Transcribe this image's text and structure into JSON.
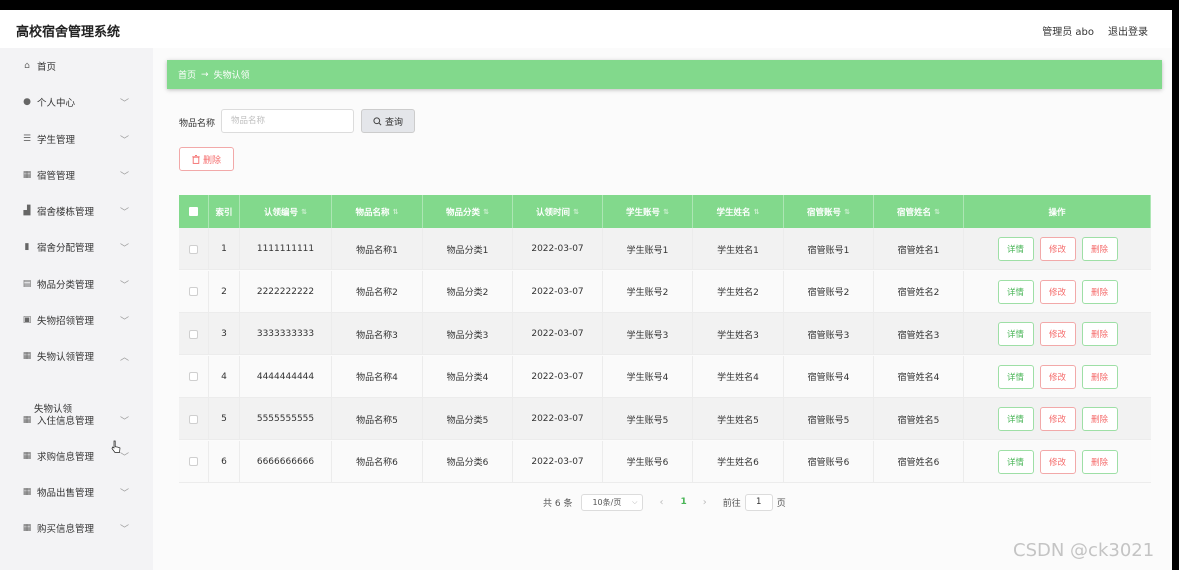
{
  "app_title": "高校宿舍管理系统",
  "header": {
    "user_label": "管理员 abo",
    "logout_label": "退出登录"
  },
  "sidebar": {
    "items": [
      {
        "label": "首页",
        "icon": "home-icon"
      },
      {
        "label": "个人中心",
        "icon": "user-icon"
      },
      {
        "label": "学生管理",
        "icon": "sliders-icon"
      },
      {
        "label": "宿管管理",
        "icon": "grid-icon"
      },
      {
        "label": "宿舍楼栋管理",
        "icon": "building-icon"
      },
      {
        "label": "宿舍分配管理",
        "icon": "bar-chart-icon"
      },
      {
        "label": "物品分类管理",
        "icon": "clipboard-icon"
      },
      {
        "label": "失物招领管理",
        "icon": "image-icon"
      },
      {
        "label": "失物认领管理",
        "icon": "grid-icon",
        "expanded": true
      },
      {
        "label": "入住信息管理",
        "icon": "grid-icon"
      },
      {
        "label": "求购信息管理",
        "icon": "grid-icon"
      },
      {
        "label": "物品出售管理",
        "icon": "grid-icon"
      },
      {
        "label": "购买信息管理",
        "icon": "grid-icon"
      }
    ],
    "sub_item": "失物认领"
  },
  "breadcrumb": {
    "home": "首页",
    "arrow": "→",
    "current": "失物认领"
  },
  "search": {
    "label": "物品名称",
    "placeholder": "物品名称",
    "button": "查询"
  },
  "toolbar": {
    "delete_label": "删除"
  },
  "table": {
    "columns": [
      "索引",
      "认领编号",
      "物品名称",
      "物品分类",
      "认领时间",
      "学生账号",
      "学生姓名",
      "宿管账号",
      "宿管姓名",
      "操作"
    ],
    "rows": [
      {
        "index": "1",
        "code": "1111111111",
        "item_name": "物品名称1",
        "category": "物品分类1",
        "time": "2022-03-07",
        "student_account": "学生账号1",
        "student_name": "学生姓名1",
        "manager_account": "宿管账号1",
        "manager_name": "宿管姓名1"
      },
      {
        "index": "2",
        "code": "2222222222",
        "item_name": "物品名称2",
        "category": "物品分类2",
        "time": "2022-03-07",
        "student_account": "学生账号2",
        "student_name": "学生姓名2",
        "manager_account": "宿管账号2",
        "manager_name": "宿管姓名2"
      },
      {
        "index": "3",
        "code": "3333333333",
        "item_name": "物品名称3",
        "category": "物品分类3",
        "time": "2022-03-07",
        "student_account": "学生账号3",
        "student_name": "学生姓名3",
        "manager_account": "宿管账号3",
        "manager_name": "宿管姓名3"
      },
      {
        "index": "4",
        "code": "4444444444",
        "item_name": "物品名称4",
        "category": "物品分类4",
        "time": "2022-03-07",
        "student_account": "学生账号4",
        "student_name": "学生姓名4",
        "manager_account": "宿管账号4",
        "manager_name": "宿管姓名4"
      },
      {
        "index": "5",
        "code": "5555555555",
        "item_name": "物品名称5",
        "category": "物品分类5",
        "time": "2022-03-07",
        "student_account": "学生账号5",
        "student_name": "学生姓名5",
        "manager_account": "宿管账号5",
        "manager_name": "宿管姓名5"
      },
      {
        "index": "6",
        "code": "6666666666",
        "item_name": "物品名称6",
        "category": "物品分类6",
        "time": "2022-03-07",
        "student_account": "学生账号6",
        "student_name": "学生姓名6",
        "manager_account": "宿管账号6",
        "manager_name": "宿管姓名6"
      }
    ],
    "actions": {
      "detail": "详情",
      "edit": "修改",
      "delete": "删除"
    }
  },
  "pagination": {
    "total": "共 6 条",
    "page_size": "10条/页",
    "current": "1",
    "goto_label": "前往",
    "goto_value": "1",
    "page_suffix": "页"
  },
  "watermark": "CSDN @ck3021",
  "colors": {
    "accent": "#82d98c",
    "danger": "#f56c6c",
    "success_text": "#49b557"
  }
}
